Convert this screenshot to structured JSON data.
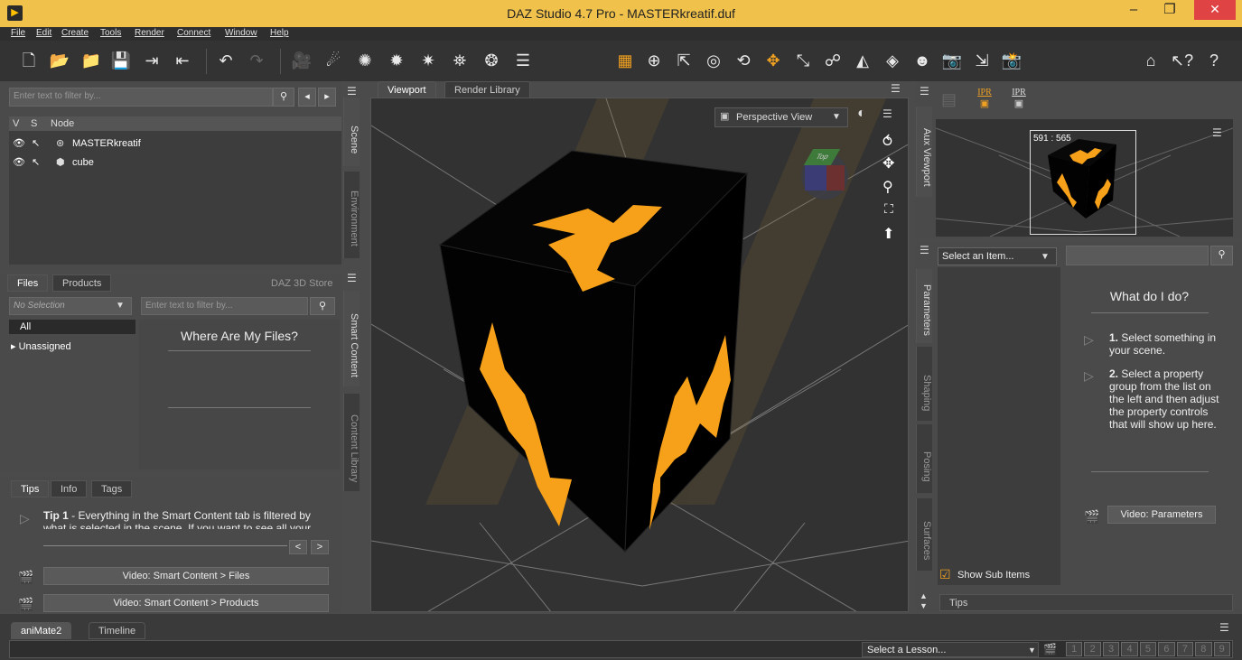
{
  "window": {
    "title": "DAZ Studio 4.7 Pro - MASTERkreatif.duf",
    "controls": [
      "–",
      "❐",
      "✕"
    ]
  },
  "menu": [
    "File",
    "Edit",
    "Create",
    "Tools",
    "Render",
    "Connect",
    "Window",
    "Help"
  ],
  "scene": {
    "filter_placeholder": "Enter text to filter by...",
    "columns": [
      "V",
      "S",
      "Node"
    ],
    "nodes": [
      "MASTERkreatif",
      "cube"
    ],
    "side_tabs": [
      "Scene",
      "Environment"
    ]
  },
  "files": {
    "tabs": [
      "Files",
      "Products"
    ],
    "store_label": "DAZ 3D Store",
    "selection": "No Selection",
    "filter_placeholder": "Enter text to filter by...",
    "categories": [
      "All",
      "▸ Unassigned"
    ],
    "heading": "Where Are My Files?",
    "side_tabs": [
      "Smart Content",
      "Content Library"
    ]
  },
  "tips": {
    "tabs": [
      "Tips",
      "Info",
      "Tags"
    ],
    "tip_bold": "Tip 1",
    "tip_text": " - Everything in the Smart Content tab is filtered by what is selected in the scene. If you want to see all your",
    "video1": "Video: Smart Content > Files",
    "video2": "Video: Smart Content > Products",
    "nav_prev": "<",
    "nav_next": ">"
  },
  "viewport": {
    "tabs": [
      "Viewport",
      "Render Library"
    ],
    "view_mode": "Perspective View",
    "cube_face_label": "Top"
  },
  "aux": {
    "side_tab": "Aux Viewport",
    "ipr1": "IPR",
    "ipr2": "IPR",
    "dims": "591 : 565"
  },
  "params": {
    "side_tabs": [
      "Parameters",
      "Shaping",
      "Posing",
      "Surfaces"
    ],
    "select_item": "Select an Item...",
    "show_sub_items": "Show Sub Items",
    "heading": "What do I do?",
    "step1_bold": "1.",
    "step1_text": " Select something in your scene.",
    "step2_bold": "2.",
    "step2_text": " Select a property group from the list on the left and then adjust the property controls that will show up here.",
    "video": "Video: Parameters",
    "tips_tab": "Tips"
  },
  "bottom": {
    "tabs": [
      "aniMate2",
      "Timeline"
    ],
    "lesson": "Select a Lesson...",
    "pages": [
      "1",
      "2",
      "3",
      "4",
      "5",
      "6",
      "7",
      "8",
      "9"
    ]
  },
  "colors": {
    "accent": "#f7a11a",
    "titlebar": "#f0c14b",
    "close": "#e04343"
  }
}
